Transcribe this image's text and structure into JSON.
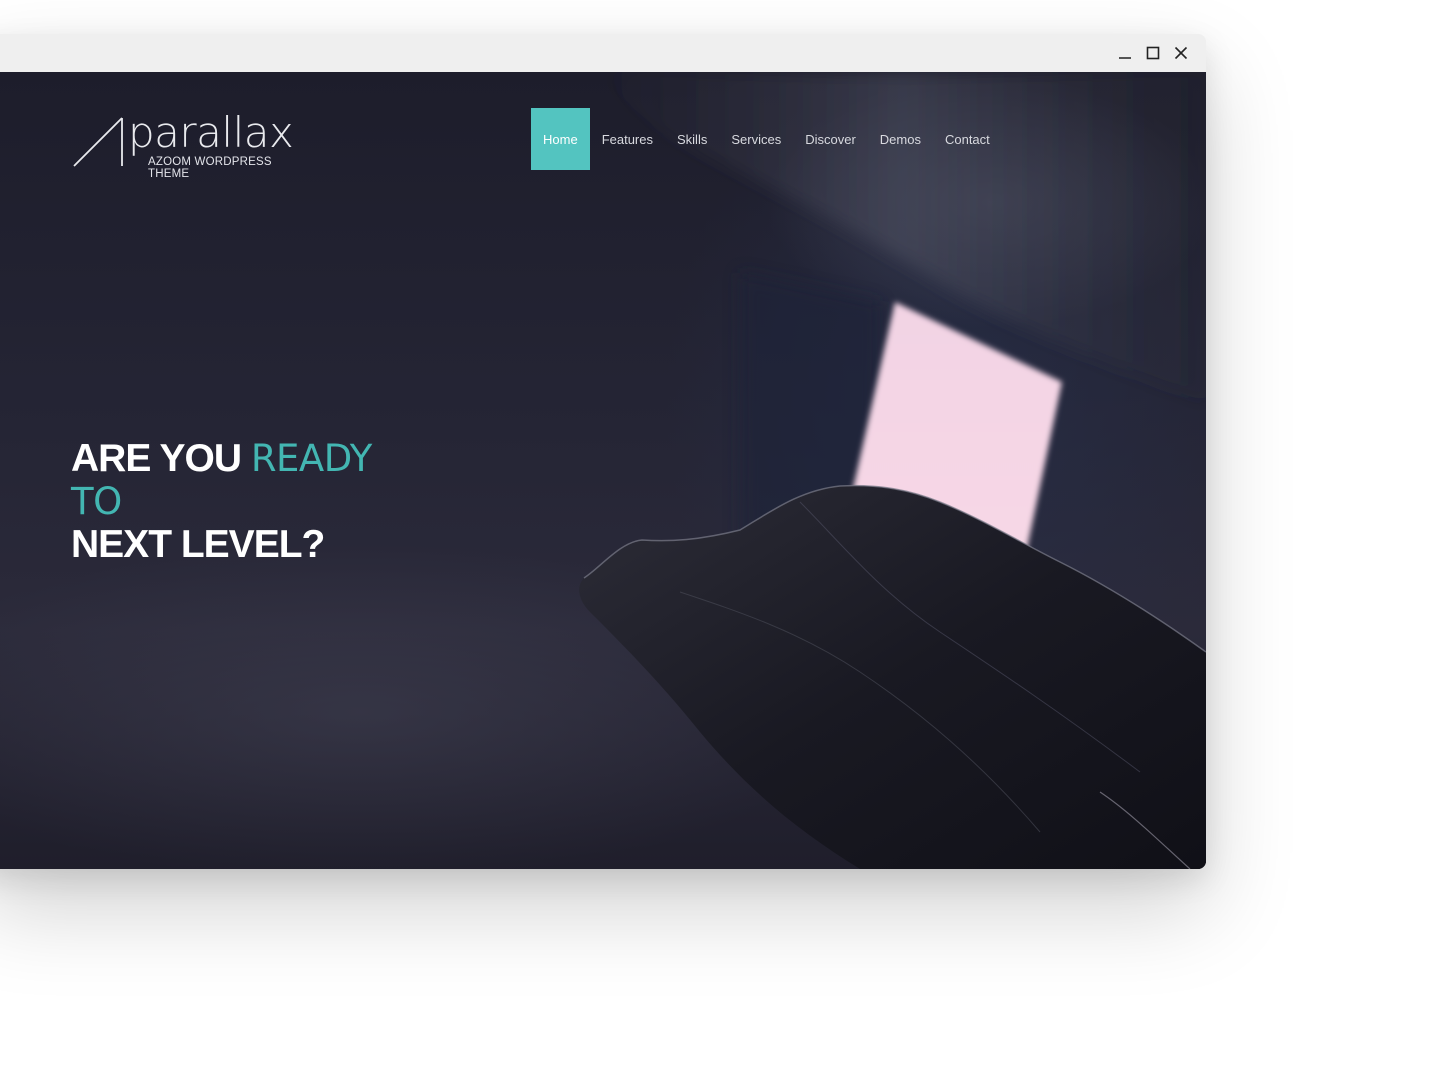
{
  "window": {
    "controls": {
      "minimize_icon": "minimize-icon",
      "maximize_icon": "maximize-icon",
      "close_icon": "close-icon"
    }
  },
  "site": {
    "logo_word": "parallax",
    "logo_sub": "AZOOM WORDPRESS THEME"
  },
  "nav": {
    "items": [
      {
        "label": "Home",
        "active": true
      },
      {
        "label": "Features"
      },
      {
        "label": "Skills"
      },
      {
        "label": "Services"
      },
      {
        "label": "Discover"
      },
      {
        "label": "Demos"
      },
      {
        "label": "Contact"
      }
    ],
    "active_color": "#53c4c0"
  },
  "hero": {
    "line1_strong": "ARE YOU",
    "line1_accent": "READY",
    "line2_accent": "TO",
    "line3_strong": "NEXT LEVEL?",
    "accent_color": "#43b6b2"
  }
}
